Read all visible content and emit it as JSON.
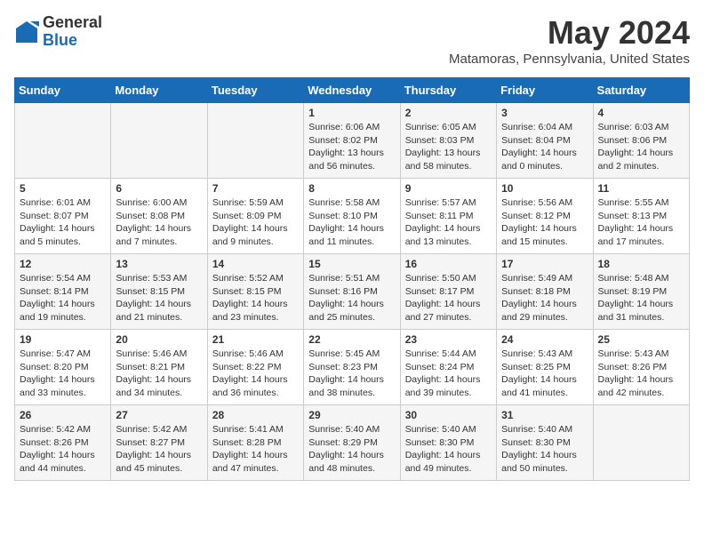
{
  "logo": {
    "general": "General",
    "blue": "Blue"
  },
  "title": "May 2024",
  "subtitle": "Matamoras, Pennsylvania, United States",
  "days_of_week": [
    "Sunday",
    "Monday",
    "Tuesday",
    "Wednesday",
    "Thursday",
    "Friday",
    "Saturday"
  ],
  "weeks": [
    [
      {
        "day": "",
        "info": ""
      },
      {
        "day": "",
        "info": ""
      },
      {
        "day": "",
        "info": ""
      },
      {
        "day": "1",
        "info": "Sunrise: 6:06 AM\nSunset: 8:02 PM\nDaylight: 13 hours\nand 56 minutes."
      },
      {
        "day": "2",
        "info": "Sunrise: 6:05 AM\nSunset: 8:03 PM\nDaylight: 13 hours\nand 58 minutes."
      },
      {
        "day": "3",
        "info": "Sunrise: 6:04 AM\nSunset: 8:04 PM\nDaylight: 14 hours\nand 0 minutes."
      },
      {
        "day": "4",
        "info": "Sunrise: 6:03 AM\nSunset: 8:06 PM\nDaylight: 14 hours\nand 2 minutes."
      }
    ],
    [
      {
        "day": "5",
        "info": "Sunrise: 6:01 AM\nSunset: 8:07 PM\nDaylight: 14 hours\nand 5 minutes."
      },
      {
        "day": "6",
        "info": "Sunrise: 6:00 AM\nSunset: 8:08 PM\nDaylight: 14 hours\nand 7 minutes."
      },
      {
        "day": "7",
        "info": "Sunrise: 5:59 AM\nSunset: 8:09 PM\nDaylight: 14 hours\nand 9 minutes."
      },
      {
        "day": "8",
        "info": "Sunrise: 5:58 AM\nSunset: 8:10 PM\nDaylight: 14 hours\nand 11 minutes."
      },
      {
        "day": "9",
        "info": "Sunrise: 5:57 AM\nSunset: 8:11 PM\nDaylight: 14 hours\nand 13 minutes."
      },
      {
        "day": "10",
        "info": "Sunrise: 5:56 AM\nSunset: 8:12 PM\nDaylight: 14 hours\nand 15 minutes."
      },
      {
        "day": "11",
        "info": "Sunrise: 5:55 AM\nSunset: 8:13 PM\nDaylight: 14 hours\nand 17 minutes."
      }
    ],
    [
      {
        "day": "12",
        "info": "Sunrise: 5:54 AM\nSunset: 8:14 PM\nDaylight: 14 hours\nand 19 minutes."
      },
      {
        "day": "13",
        "info": "Sunrise: 5:53 AM\nSunset: 8:15 PM\nDaylight: 14 hours\nand 21 minutes."
      },
      {
        "day": "14",
        "info": "Sunrise: 5:52 AM\nSunset: 8:15 PM\nDaylight: 14 hours\nand 23 minutes."
      },
      {
        "day": "15",
        "info": "Sunrise: 5:51 AM\nSunset: 8:16 PM\nDaylight: 14 hours\nand 25 minutes."
      },
      {
        "day": "16",
        "info": "Sunrise: 5:50 AM\nSunset: 8:17 PM\nDaylight: 14 hours\nand 27 minutes."
      },
      {
        "day": "17",
        "info": "Sunrise: 5:49 AM\nSunset: 8:18 PM\nDaylight: 14 hours\nand 29 minutes."
      },
      {
        "day": "18",
        "info": "Sunrise: 5:48 AM\nSunset: 8:19 PM\nDaylight: 14 hours\nand 31 minutes."
      }
    ],
    [
      {
        "day": "19",
        "info": "Sunrise: 5:47 AM\nSunset: 8:20 PM\nDaylight: 14 hours\nand 33 minutes."
      },
      {
        "day": "20",
        "info": "Sunrise: 5:46 AM\nSunset: 8:21 PM\nDaylight: 14 hours\nand 34 minutes."
      },
      {
        "day": "21",
        "info": "Sunrise: 5:46 AM\nSunset: 8:22 PM\nDaylight: 14 hours\nand 36 minutes."
      },
      {
        "day": "22",
        "info": "Sunrise: 5:45 AM\nSunset: 8:23 PM\nDaylight: 14 hours\nand 38 minutes."
      },
      {
        "day": "23",
        "info": "Sunrise: 5:44 AM\nSunset: 8:24 PM\nDaylight: 14 hours\nand 39 minutes."
      },
      {
        "day": "24",
        "info": "Sunrise: 5:43 AM\nSunset: 8:25 PM\nDaylight: 14 hours\nand 41 minutes."
      },
      {
        "day": "25",
        "info": "Sunrise: 5:43 AM\nSunset: 8:26 PM\nDaylight: 14 hours\nand 42 minutes."
      }
    ],
    [
      {
        "day": "26",
        "info": "Sunrise: 5:42 AM\nSunset: 8:26 PM\nDaylight: 14 hours\nand 44 minutes."
      },
      {
        "day": "27",
        "info": "Sunrise: 5:42 AM\nSunset: 8:27 PM\nDaylight: 14 hours\nand 45 minutes."
      },
      {
        "day": "28",
        "info": "Sunrise: 5:41 AM\nSunset: 8:28 PM\nDaylight: 14 hours\nand 47 minutes."
      },
      {
        "day": "29",
        "info": "Sunrise: 5:40 AM\nSunset: 8:29 PM\nDaylight: 14 hours\nand 48 minutes."
      },
      {
        "day": "30",
        "info": "Sunrise: 5:40 AM\nSunset: 8:30 PM\nDaylight: 14 hours\nand 49 minutes."
      },
      {
        "day": "31",
        "info": "Sunrise: 5:40 AM\nSunset: 8:30 PM\nDaylight: 14 hours\nand 50 minutes."
      },
      {
        "day": "",
        "info": ""
      }
    ]
  ]
}
